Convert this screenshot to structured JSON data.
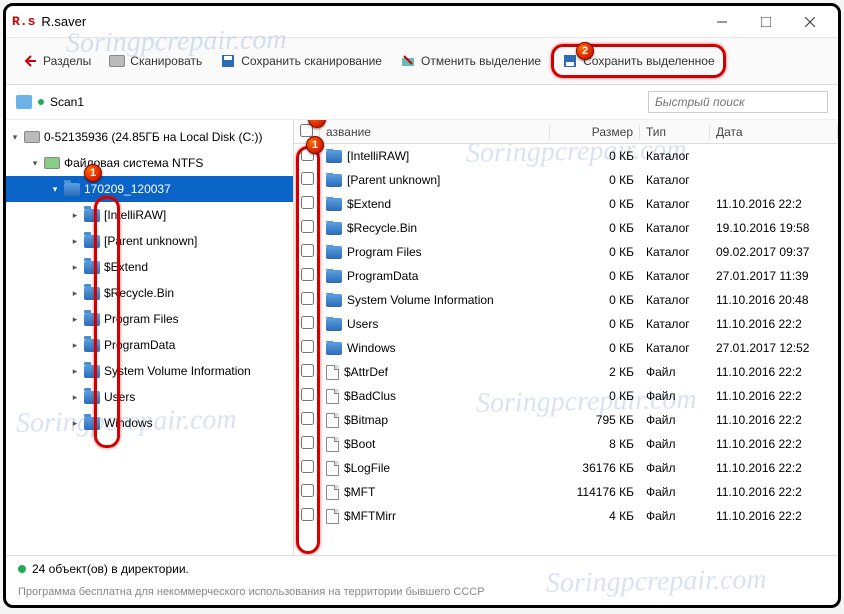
{
  "window": {
    "title": "R.saver",
    "logo": "R.s"
  },
  "toolbar": {
    "back": "Разделы",
    "scan": "Сканировать",
    "save_scan": "Сохранить сканирование",
    "cancel_sel": "Отменить выделение",
    "save_sel": "Сохранить выделенное"
  },
  "breadcrumb": {
    "scan": "Scan1"
  },
  "search": {
    "placeholder": "Быстрый поиск"
  },
  "tree": {
    "root": "0-52135936 (24.85ГБ на Local Disk (C:))",
    "fs": "Файловая система NTFS",
    "session": "170209_120037",
    "items": [
      "[IntelliRAW]",
      "[Parent unknown]",
      "$Extend",
      "$Recycle.Bin",
      "Program Files",
      "ProgramData",
      "System Volume Information",
      "Users",
      "Windows"
    ]
  },
  "columns": {
    "name": "азвание",
    "size": "Размер",
    "type": "Тип",
    "date": "Дата"
  },
  "rows": [
    {
      "name": "[IntelliRAW]",
      "size": "0 КБ",
      "type": "Каталог",
      "date": "",
      "kind": "folder"
    },
    {
      "name": "[Parent unknown]",
      "size": "0 КБ",
      "type": "Каталог",
      "date": "",
      "kind": "folder"
    },
    {
      "name": "$Extend",
      "size": "0 КБ",
      "type": "Каталог",
      "date": "11.10.2016 22:2",
      "kind": "folder"
    },
    {
      "name": "$Recycle.Bin",
      "size": "0 КБ",
      "type": "Каталог",
      "date": "19.10.2016 19:58",
      "kind": "folder"
    },
    {
      "name": "Program Files",
      "size": "0 КБ",
      "type": "Каталог",
      "date": "09.02.2017 09:37",
      "kind": "folder"
    },
    {
      "name": "ProgramData",
      "size": "0 КБ",
      "type": "Каталог",
      "date": "27.01.2017 11:39",
      "kind": "folder"
    },
    {
      "name": "System Volume Information",
      "size": "0 КБ",
      "type": "Каталог",
      "date": "11.10.2016 20:48",
      "kind": "folder"
    },
    {
      "name": "Users",
      "size": "0 КБ",
      "type": "Каталог",
      "date": "11.10.2016 22:2",
      "kind": "folder"
    },
    {
      "name": "Windows",
      "size": "0 КБ",
      "type": "Каталог",
      "date": "27.01.2017 12:52",
      "kind": "folder"
    },
    {
      "name": "$AttrDef",
      "size": "2 КБ",
      "type": "Файл",
      "date": "11.10.2016 22:2",
      "kind": "file"
    },
    {
      "name": "$BadClus",
      "size": "0 КБ",
      "type": "Файл",
      "date": "11.10.2016 22:2",
      "kind": "file"
    },
    {
      "name": "$Bitmap",
      "size": "795 КБ",
      "type": "Файл",
      "date": "11.10.2016 22:2",
      "kind": "file"
    },
    {
      "name": "$Boot",
      "size": "8 КБ",
      "type": "Файл",
      "date": "11.10.2016 22:2",
      "kind": "file"
    },
    {
      "name": "$LogFile",
      "size": "36176 КБ",
      "type": "Файл",
      "date": "11.10.2016 22:2",
      "kind": "file"
    },
    {
      "name": "$MFT",
      "size": "114176 КБ",
      "type": "Файл",
      "date": "11.10.2016 22:2",
      "kind": "file"
    },
    {
      "name": "$MFTMirr",
      "size": "4 КБ",
      "type": "Файл",
      "date": "11.10.2016 22:2",
      "kind": "file"
    }
  ],
  "status": "24 объект(ов) в директории.",
  "footer": "Программа бесплатна для некоммерческого использования на территории бывшего СССР",
  "badges": {
    "b1": "1",
    "b2": "2"
  },
  "watermark": "Soringpcrepair.com"
}
